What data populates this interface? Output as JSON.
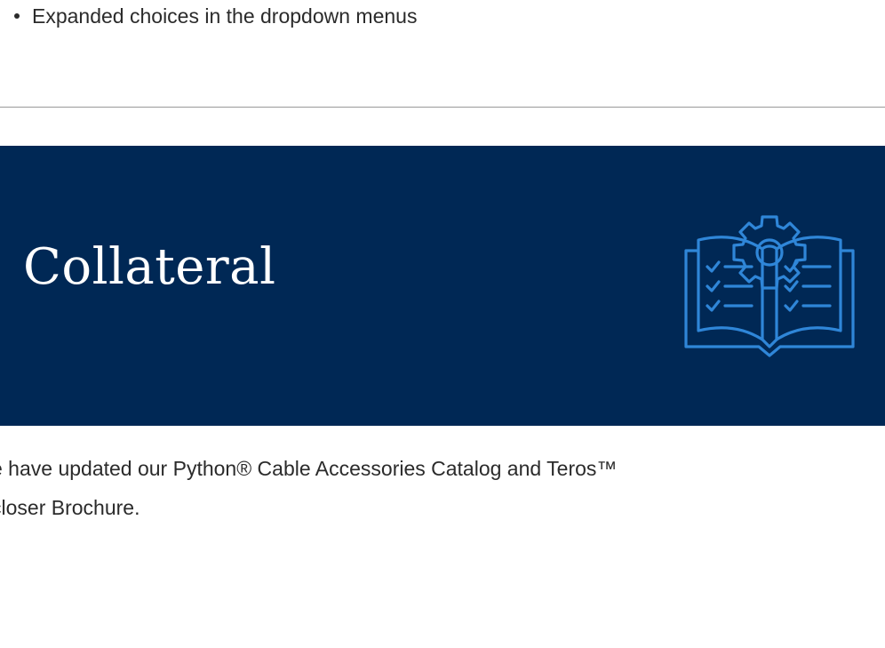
{
  "list": {
    "items": [
      {
        "text": "Expanded choices in the dropdown menus"
      }
    ]
  },
  "banner": {
    "title": "Collateral",
    "background": "#002855",
    "icon": "open-book-checklist-gear-icon",
    "icon_color": "#2f86d8"
  },
  "body": {
    "line1": "e have updated our Python® Cable Accessories Catalog and Teros™",
    "line2": "closer Brochure."
  }
}
